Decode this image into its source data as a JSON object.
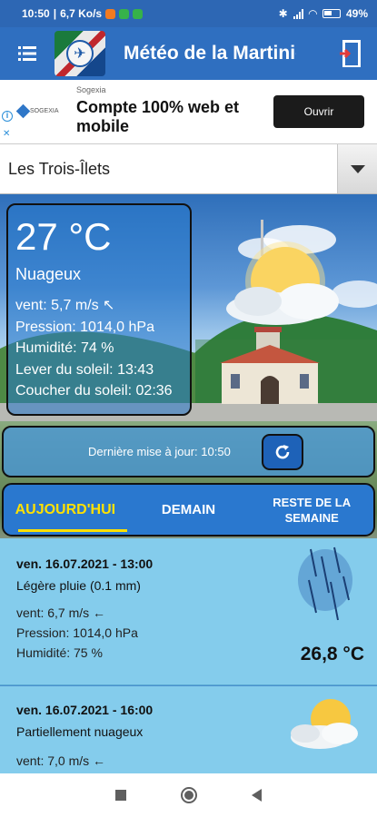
{
  "status_bar": {
    "time": "10:50",
    "net_speed": "6,7 Ko/s",
    "battery": "49%"
  },
  "app_bar": {
    "title": "Météo de la Martinique"
  },
  "ad": {
    "sponsor": "Sogexia",
    "logo_text": "SOGEXIA",
    "headline": "Compte 100% web et mobile",
    "button": "Ouvrir"
  },
  "city_select": {
    "value": "Les Trois-Îlets"
  },
  "current": {
    "temperature": "27 °C",
    "condition": "Nuageux",
    "wind": "vent: 5,7 m/s ↖",
    "pressure": "Pression: 1014,0 hPa",
    "humidity": "Humidité: 74 %",
    "sunrise": "Lever du soleil: 13:43",
    "sunset": "Coucher du soleil: 02:36"
  },
  "update": {
    "text": "Dernière mise à jour: 10:50"
  },
  "tabs": [
    {
      "label": "AUJOURD'HUI",
      "active": true
    },
    {
      "label": "DEMAIN",
      "active": false
    },
    {
      "label": "RESTE DE LA SEMAINE",
      "active": false
    }
  ],
  "forecast": [
    {
      "datetime": "ven. 16.07.2021 - 13:00",
      "description": "Légère pluie (0.1 mm)",
      "wind": "vent: 6,7 m/s ←",
      "pressure": "Pression: 1014,0 hPa",
      "humidity": "Humidité: 75 %",
      "temperature": "26,8 °C",
      "icon": "rain-icon"
    },
    {
      "datetime": "ven. 16.07.2021 - 16:00",
      "description": "Partiellement nuageux",
      "wind": "vent: 7,0 m/s ←",
      "icon": "partly-cloudy-icon"
    }
  ],
  "colors": {
    "app_bar": "#2f6fc0",
    "active_tab": "#ffe100",
    "forecast_bg": "#84ccec"
  }
}
